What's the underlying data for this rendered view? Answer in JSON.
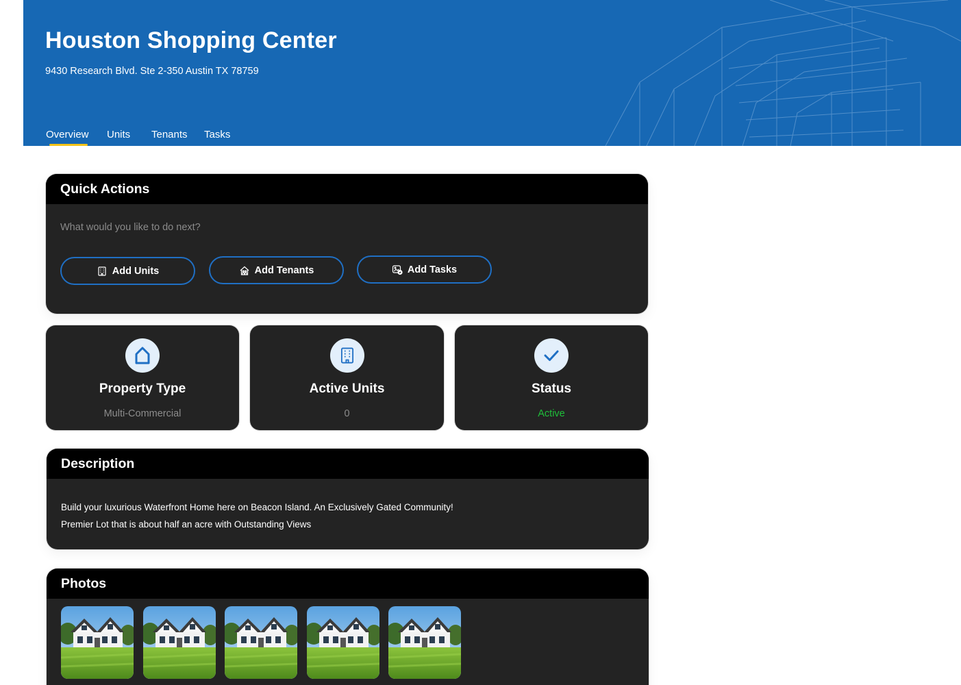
{
  "property": {
    "title": "Houston Shopping Center",
    "address": "9430 Research Blvd. Ste 2-350 Austin TX 78759"
  },
  "tabs": [
    {
      "label": "Overview",
      "active": true
    },
    {
      "label": "Units",
      "active": false
    },
    {
      "label": "Tenants",
      "active": false
    },
    {
      "label": "Tasks",
      "active": false
    }
  ],
  "quick_actions": {
    "title": "Quick Actions",
    "subtitle": "What would you like to do next?",
    "buttons": [
      {
        "label": "Add Units",
        "icon": "building-icon"
      },
      {
        "label": "Add Tenants",
        "icon": "house-people-icon"
      },
      {
        "label": "Add Tasks",
        "icon": "task-image-icon"
      }
    ]
  },
  "stats": [
    {
      "label": "Property Type",
      "value": "Multi-Commercial",
      "icon": "home-icon",
      "value_color": "#8c8c8c"
    },
    {
      "label": "Active Units",
      "value": "0",
      "icon": "building-icon",
      "value_color": "#8c8c8c"
    },
    {
      "label": "Status",
      "value": "Active",
      "icon": "check-icon",
      "value_color": "#1fbf3a"
    }
  ],
  "description": {
    "title": "Description",
    "lines": [
      "Build your luxurious Waterfront Home here on Beacon Island. An Exclusively Gated Community!",
      "Premier Lot that is about half an acre with Outstanding Views"
    ]
  },
  "photos": {
    "title": "Photos",
    "count": 5
  },
  "colors": {
    "banner": "#1768b4",
    "accent": "#1f6fc4",
    "tab_underline": "#f3c318",
    "card": "#232323",
    "card_header": "#000000",
    "status_active": "#1fbf3a"
  }
}
